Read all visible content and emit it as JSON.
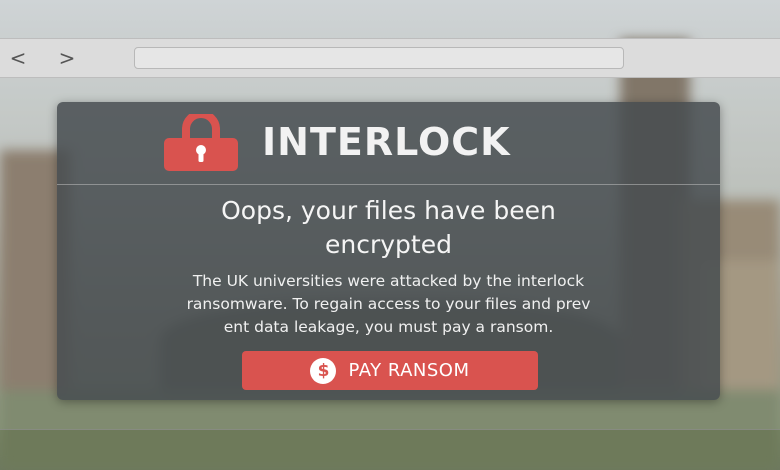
{
  "browser": {
    "back_symbol": "<",
    "forward_symbol": ">",
    "address": ""
  },
  "dialog": {
    "brand": "INTERLOCK",
    "headline_line1": "Oops, your files have been",
    "headline_line2": "encrypted",
    "message_line1": "The UK universities were attacked by the interlock",
    "message_line2": "ransomware. To regain access to your files and prev",
    "message_line3": "ent data leakage, you must pay a ransom.",
    "pay_button_label": "PAY RANSOM",
    "pay_icon_symbol": "$",
    "icons": [
      "lock-icon",
      "dollar-icon"
    ]
  },
  "colors": {
    "accent_red": "#d9534f",
    "dialog_bg": "#464c50",
    "toolbar_bg": "#dcdcdc"
  }
}
